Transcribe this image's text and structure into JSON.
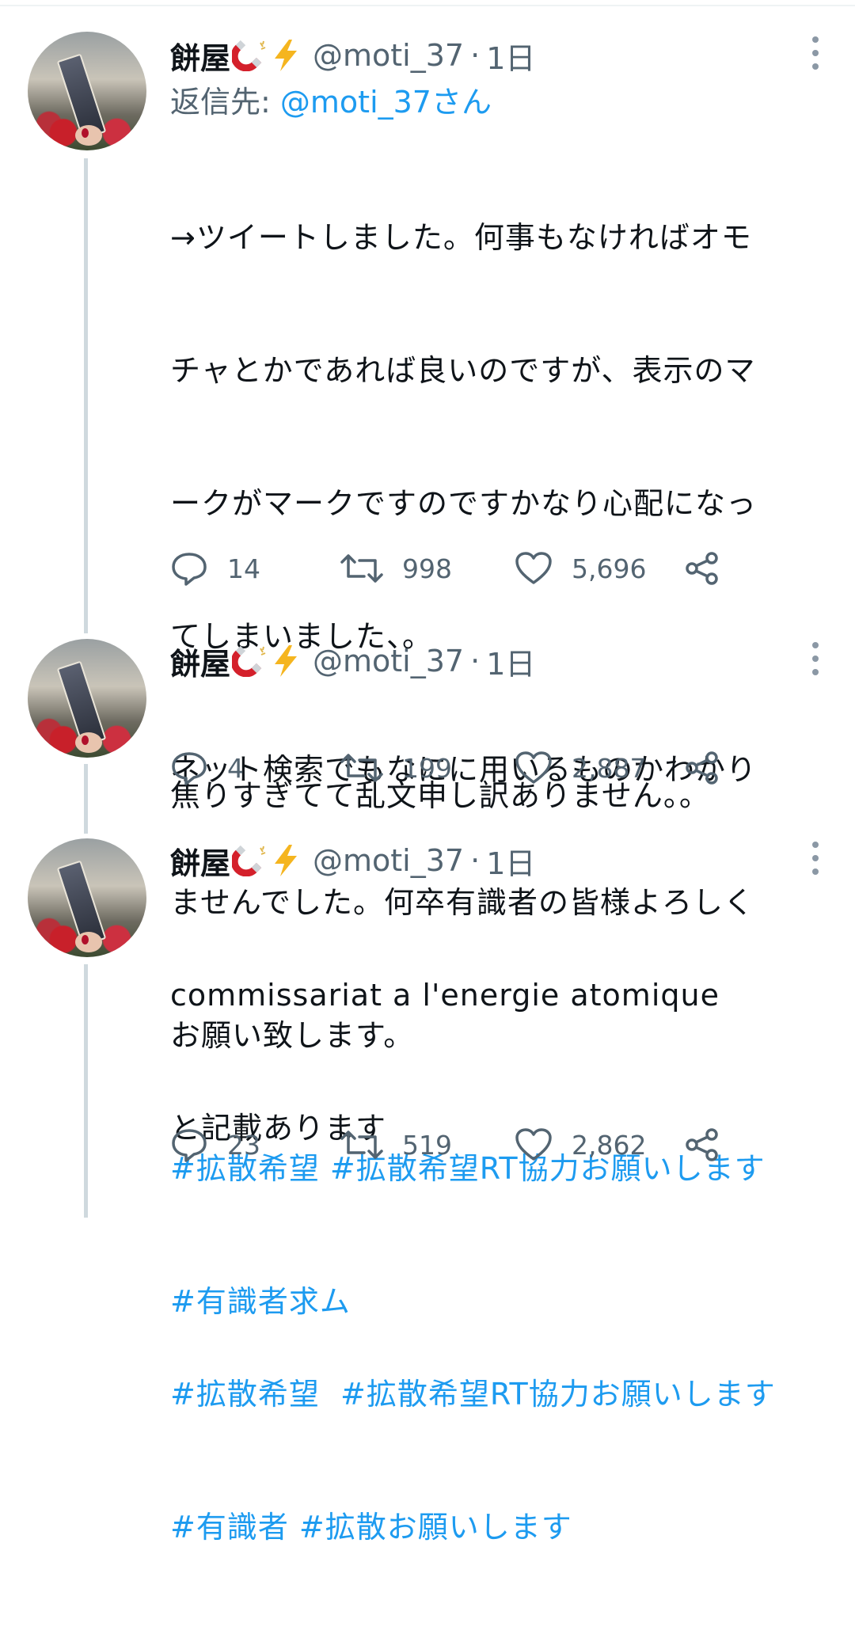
{
  "colors": {
    "link": "#1d9bf0",
    "secondary": "#536471",
    "text": "#0f1419",
    "thread_line": "#cfd9de"
  },
  "tweets": [
    {
      "author_name": "餅屋",
      "badges": [
        "magnet-icon",
        "lightning-icon"
      ],
      "handle": "@moti_37",
      "separator": "·",
      "time": "1日",
      "reply_label": "返信先:",
      "reply_mention": "@moti_37さん",
      "body_lines": [
        "→ツイートしました。何事もなければオモ",
        "チャとかであれば良いのですが、表示のマ",
        "ークがマークですのですかなり心配になっ",
        "てしまいました、。",
        "ネット検索でもなにに用いるものかわかり",
        "ませんでした。何卒有識者の皆様よろしく",
        "お願い致します。"
      ],
      "hashtag_lines": [
        "#拡散希望 #拡散希望RT協力お願いします",
        "#有識者求ム"
      ],
      "replies": "14",
      "retweets": "998",
      "likes": "5,696"
    },
    {
      "author_name": "餅屋",
      "badges": [
        "magnet-icon",
        "lightning-icon"
      ],
      "handle": "@moti_37",
      "separator": "·",
      "time": "1日",
      "body_lines": [
        "焦りすぎてて乱文申し訳ありません。。"
      ],
      "replies": "4",
      "retweets": "199",
      "likes": "2,887"
    },
    {
      "author_name": "餅屋",
      "badges": [
        "magnet-icon",
        "lightning-icon"
      ],
      "handle": "@moti_37",
      "separator": "·",
      "time": "1日",
      "body_lines": [
        "commissariat a l'energie atomique",
        "と記載あります",
        ""
      ],
      "hashtag_lines": [
        "#拡散希望  #拡散希望RT協力お願いします",
        "#有識者 #拡散お願いします"
      ],
      "replies": "23",
      "retweets": "519",
      "likes": "2,862"
    }
  ]
}
